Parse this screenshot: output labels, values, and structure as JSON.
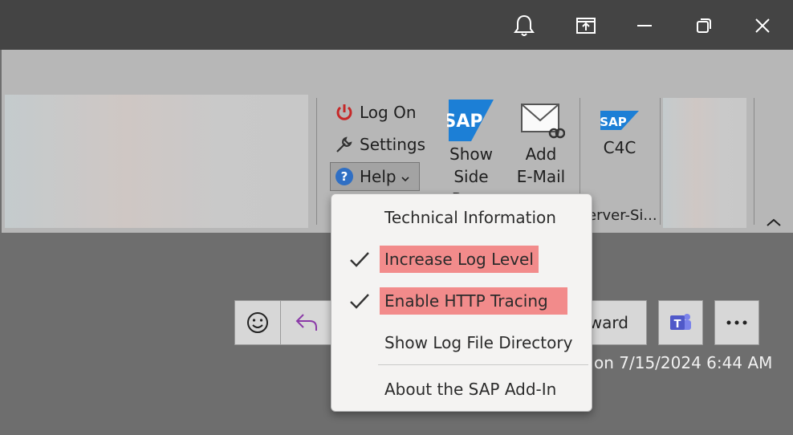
{
  "window": {
    "controls": [
      "bell-icon",
      "share-icon",
      "minimize-icon",
      "restore-icon",
      "close-icon"
    ]
  },
  "ribbon": {
    "sap_group": {
      "log_on": "Log On",
      "settings": "Settings",
      "help": "Help"
    },
    "show_side_pane": {
      "line1": "Show",
      "line2": "Side Pane"
    },
    "add_email": {
      "line1": "Add",
      "line2": "E-Mail"
    },
    "c4c": "C4C",
    "group_label_partial": "erver-Si..."
  },
  "help_menu": {
    "items": [
      {
        "label": "Technical Information",
        "checked": false,
        "highlighted": false
      },
      {
        "label": "Increase Log Level",
        "checked": true,
        "highlighted": true
      },
      {
        "label": "Enable HTTP Tracing",
        "checked": true,
        "highlighted": true
      },
      {
        "label": "Show Log File Directory",
        "checked": false,
        "highlighted": false
      },
      {
        "label": "About the SAP Add-In",
        "checked": false,
        "highlighted": false
      }
    ]
  },
  "message_bar": {
    "forward_partial": "rward",
    "timestamp_partial": "on 7/15/2024 6:44 AM"
  },
  "colors": {
    "highlight": "#f28b8b",
    "power_red": "#c62828",
    "help_blue": "#2f6fc4",
    "sap_blue": "#1c7fd6"
  }
}
